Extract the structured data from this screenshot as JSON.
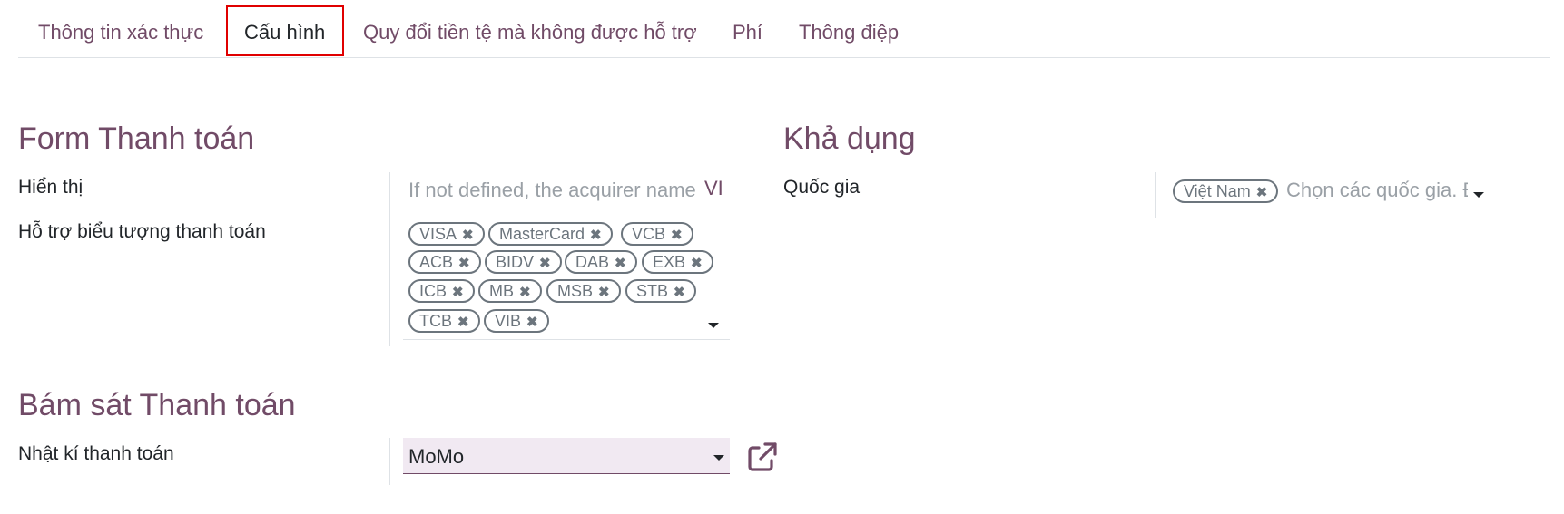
{
  "tabs": [
    {
      "label": "Thông tin xác thực"
    },
    {
      "label": "Cấu hình"
    },
    {
      "label": "Quy đổi tiền tệ mà không được hỗ trợ"
    },
    {
      "label": "Phí"
    },
    {
      "label": "Thông điệp"
    }
  ],
  "form": {
    "title": "Form Thanh toán",
    "display_label": "Hiển thị",
    "display_placeholder": "If not defined, the acquirer name",
    "lang_code": "VI",
    "icons_label": "Hỗ trợ biểu tượng thanh toán",
    "icons": [
      "VISA",
      "MasterCard",
      "VCB",
      "ACB",
      "BIDV",
      "DAB",
      "EXB",
      "ICB",
      "MB",
      "MSB",
      "STB",
      "TCB",
      "VIB"
    ],
    "remove_glyph": "✖"
  },
  "availability": {
    "title": "Khả dụng",
    "country_label": "Quốc gia",
    "countries": [
      "Việt Nam"
    ],
    "country_placeholder": "Chọn các quốc gia. Để trống để khả dụng ở mọi nơi"
  },
  "tracking": {
    "title": "Bám sát Thanh toán",
    "journal_label": "Nhật kí thanh toán",
    "journal_value": "MoMo"
  },
  "colors": {
    "accent": "#714B67",
    "highlight_border": "#e00000",
    "select_bg": "#f1e9f2",
    "tag_border": "#6c757d"
  }
}
